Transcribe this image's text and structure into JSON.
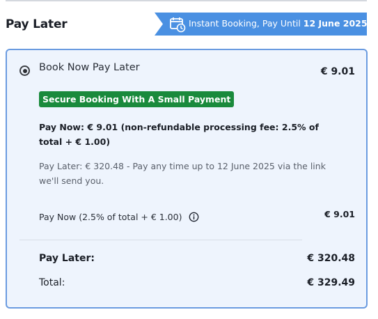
{
  "section": {
    "title": "Pay Later"
  },
  "banner": {
    "icon": "calendar-clock-icon",
    "text": "Instant Booking, Pay Until ",
    "date": "12 June 2025",
    "color": "#4a90e2"
  },
  "option": {
    "selected": true,
    "title": "Book Now Pay Later",
    "price": "€ 9.01",
    "badge": "Secure Booking With A Small Payment",
    "badge_color": "#1a8a3c",
    "pay_now_text": "Pay Now: € 9.01 (non-refundable processing fee: 2.5% of total + € 1.00)",
    "pay_later_text": "Pay Later: € 320.48 - Pay any time up to 12 June 2025 via the link we'll send you.",
    "breakdown": {
      "label": "Pay Now (2.5% of total + € 1.00)",
      "info_icon": "info-icon",
      "value": "€ 9.01"
    },
    "summary": {
      "pay_later_label": "Pay Later:",
      "pay_later_value": "€ 320.48",
      "total_label": "Total:",
      "total_value": "€ 329.49"
    },
    "card_border_color": "#6a9be0",
    "card_background": "#eef4fd"
  }
}
